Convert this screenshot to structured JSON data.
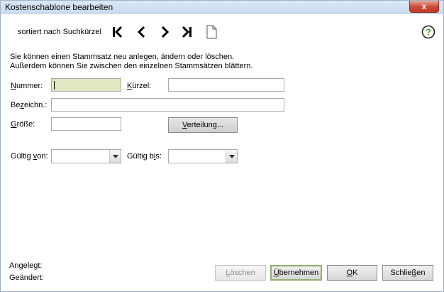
{
  "window": {
    "title": "Kostenschablone bearbeiten",
    "close_glyph": "x"
  },
  "toolbar": {
    "sort_text": "sortiert nach Suchkürzel",
    "icons": [
      "first-record-icon",
      "previous-record-icon",
      "next-record-icon",
      "last-record-icon",
      "new-record-icon"
    ]
  },
  "help": {
    "glyph": "?"
  },
  "info": {
    "line1": "Sie können einen Stammsatz neu anlegen, ändern oder löschen.",
    "line2": "Außerdem können Sie zwischen den einzelnen Stammsätzen blättern."
  },
  "form": {
    "nummer": {
      "label_pre": "",
      "label_key": "N",
      "label_post": "ummer:",
      "value": ""
    },
    "kuerzel": {
      "label_pre": "",
      "label_key": "K",
      "label_post": "ürzel:",
      "value": ""
    },
    "bezeichnung": {
      "label_pre": "Be",
      "label_key": "z",
      "label_post": "eichn.:",
      "value": ""
    },
    "groesse": {
      "label_pre": "",
      "label_key": "G",
      "label_post": "röße:",
      "value": ""
    },
    "verteilung_button": {
      "pre": "",
      "key": "V",
      "post": "erteilung..."
    },
    "gueltig_von": {
      "label_pre": "Gültig ",
      "label_key": "v",
      "label_post": "on:",
      "value": ""
    },
    "gueltig_bis": {
      "label_pre": "Gültig b",
      "label_key": "i",
      "label_post": "s:",
      "value": ""
    }
  },
  "footer": {
    "angelegt": "Angelegt:",
    "geaendert": "Geändert:",
    "loeschen": {
      "pre": "",
      "key": "L",
      "post": "öschen"
    },
    "uebernehmen": {
      "pre": "",
      "key": "Ü",
      "post": "bernehmen"
    },
    "ok": {
      "pre": "",
      "key": "O",
      "post": "K"
    },
    "schliessen": {
      "pre": "Schlie",
      "key": "ß",
      "post": "en"
    }
  },
  "colors": {
    "titlebar": "#c9daef",
    "highlight_field": "#e0e7c3",
    "close": "#c94a36",
    "primary_border": "#8fb06a"
  }
}
